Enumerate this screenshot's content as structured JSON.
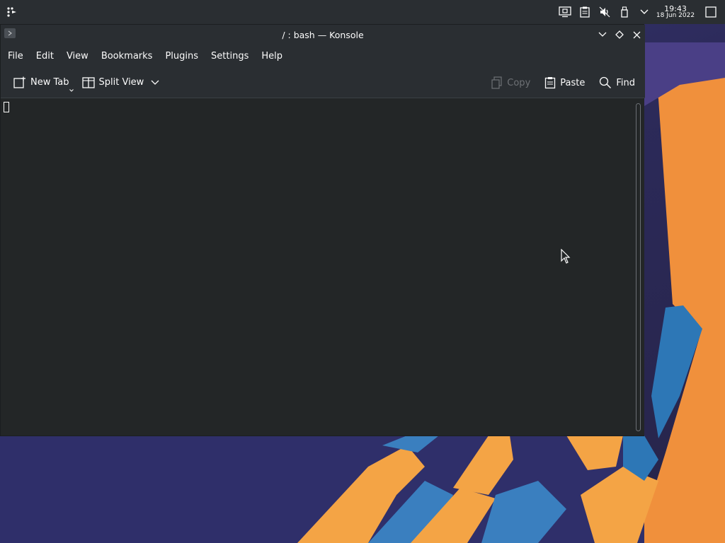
{
  "panel": {
    "launcher_icon": "kde-application-launcher-icon",
    "tray_icons": [
      "display-configuration-icon",
      "clipboard-icon",
      "volume-muted-icon",
      "usb-device-icon",
      "chevron-down-icon"
    ],
    "clock_time": "19:43",
    "clock_date": "18 Jun 2022",
    "show_desktop_icon": "show-desktop-icon"
  },
  "window": {
    "title": "/ : bash — Konsole",
    "buttons": [
      "minimize-icon",
      "maximize-icon",
      "close-icon"
    ]
  },
  "menubar": {
    "items": [
      "File",
      "Edit",
      "View",
      "Bookmarks",
      "Plugins",
      "Settings",
      "Help"
    ]
  },
  "toolbar": {
    "new_tab_label": "New Tab",
    "split_view_label": "Split View",
    "copy_label": "Copy",
    "paste_label": "Paste",
    "find_label": "Find"
  },
  "colors": {
    "panel": "#2a2e32",
    "terminal_bg": "#232627",
    "text": "#fcfcfc",
    "disabled_text": "#6e7175",
    "wallpaper_orange": "#f0983f",
    "wallpaper_blue": "#2e7fbf"
  }
}
